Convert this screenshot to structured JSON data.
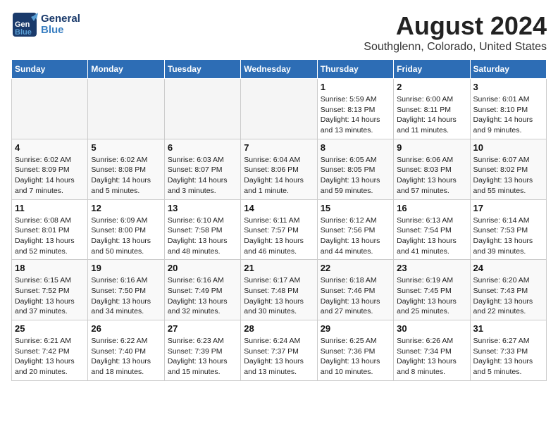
{
  "header": {
    "logo_general": "General",
    "logo_blue": "Blue",
    "month_year": "August 2024",
    "location": "Southglenn, Colorado, United States"
  },
  "weekdays": [
    "Sunday",
    "Monday",
    "Tuesday",
    "Wednesday",
    "Thursday",
    "Friday",
    "Saturday"
  ],
  "weeks": [
    [
      {
        "day": "",
        "info": ""
      },
      {
        "day": "",
        "info": ""
      },
      {
        "day": "",
        "info": ""
      },
      {
        "day": "",
        "info": ""
      },
      {
        "day": "1",
        "info": "Sunrise: 5:59 AM\nSunset: 8:13 PM\nDaylight: 14 hours\nand 13 minutes."
      },
      {
        "day": "2",
        "info": "Sunrise: 6:00 AM\nSunset: 8:11 PM\nDaylight: 14 hours\nand 11 minutes."
      },
      {
        "day": "3",
        "info": "Sunrise: 6:01 AM\nSunset: 8:10 PM\nDaylight: 14 hours\nand 9 minutes."
      }
    ],
    [
      {
        "day": "4",
        "info": "Sunrise: 6:02 AM\nSunset: 8:09 PM\nDaylight: 14 hours\nand 7 minutes."
      },
      {
        "day": "5",
        "info": "Sunrise: 6:02 AM\nSunset: 8:08 PM\nDaylight: 14 hours\nand 5 minutes."
      },
      {
        "day": "6",
        "info": "Sunrise: 6:03 AM\nSunset: 8:07 PM\nDaylight: 14 hours\nand 3 minutes."
      },
      {
        "day": "7",
        "info": "Sunrise: 6:04 AM\nSunset: 8:06 PM\nDaylight: 14 hours\nand 1 minute."
      },
      {
        "day": "8",
        "info": "Sunrise: 6:05 AM\nSunset: 8:05 PM\nDaylight: 13 hours\nand 59 minutes."
      },
      {
        "day": "9",
        "info": "Sunrise: 6:06 AM\nSunset: 8:03 PM\nDaylight: 13 hours\nand 57 minutes."
      },
      {
        "day": "10",
        "info": "Sunrise: 6:07 AM\nSunset: 8:02 PM\nDaylight: 13 hours\nand 55 minutes."
      }
    ],
    [
      {
        "day": "11",
        "info": "Sunrise: 6:08 AM\nSunset: 8:01 PM\nDaylight: 13 hours\nand 52 minutes."
      },
      {
        "day": "12",
        "info": "Sunrise: 6:09 AM\nSunset: 8:00 PM\nDaylight: 13 hours\nand 50 minutes."
      },
      {
        "day": "13",
        "info": "Sunrise: 6:10 AM\nSunset: 7:58 PM\nDaylight: 13 hours\nand 48 minutes."
      },
      {
        "day": "14",
        "info": "Sunrise: 6:11 AM\nSunset: 7:57 PM\nDaylight: 13 hours\nand 46 minutes."
      },
      {
        "day": "15",
        "info": "Sunrise: 6:12 AM\nSunset: 7:56 PM\nDaylight: 13 hours\nand 44 minutes."
      },
      {
        "day": "16",
        "info": "Sunrise: 6:13 AM\nSunset: 7:54 PM\nDaylight: 13 hours\nand 41 minutes."
      },
      {
        "day": "17",
        "info": "Sunrise: 6:14 AM\nSunset: 7:53 PM\nDaylight: 13 hours\nand 39 minutes."
      }
    ],
    [
      {
        "day": "18",
        "info": "Sunrise: 6:15 AM\nSunset: 7:52 PM\nDaylight: 13 hours\nand 37 minutes."
      },
      {
        "day": "19",
        "info": "Sunrise: 6:16 AM\nSunset: 7:50 PM\nDaylight: 13 hours\nand 34 minutes."
      },
      {
        "day": "20",
        "info": "Sunrise: 6:16 AM\nSunset: 7:49 PM\nDaylight: 13 hours\nand 32 minutes."
      },
      {
        "day": "21",
        "info": "Sunrise: 6:17 AM\nSunset: 7:48 PM\nDaylight: 13 hours\nand 30 minutes."
      },
      {
        "day": "22",
        "info": "Sunrise: 6:18 AM\nSunset: 7:46 PM\nDaylight: 13 hours\nand 27 minutes."
      },
      {
        "day": "23",
        "info": "Sunrise: 6:19 AM\nSunset: 7:45 PM\nDaylight: 13 hours\nand 25 minutes."
      },
      {
        "day": "24",
        "info": "Sunrise: 6:20 AM\nSunset: 7:43 PM\nDaylight: 13 hours\nand 22 minutes."
      }
    ],
    [
      {
        "day": "25",
        "info": "Sunrise: 6:21 AM\nSunset: 7:42 PM\nDaylight: 13 hours\nand 20 minutes."
      },
      {
        "day": "26",
        "info": "Sunrise: 6:22 AM\nSunset: 7:40 PM\nDaylight: 13 hours\nand 18 minutes."
      },
      {
        "day": "27",
        "info": "Sunrise: 6:23 AM\nSunset: 7:39 PM\nDaylight: 13 hours\nand 15 minutes."
      },
      {
        "day": "28",
        "info": "Sunrise: 6:24 AM\nSunset: 7:37 PM\nDaylight: 13 hours\nand 13 minutes."
      },
      {
        "day": "29",
        "info": "Sunrise: 6:25 AM\nSunset: 7:36 PM\nDaylight: 13 hours\nand 10 minutes."
      },
      {
        "day": "30",
        "info": "Sunrise: 6:26 AM\nSunset: 7:34 PM\nDaylight: 13 hours\nand 8 minutes."
      },
      {
        "day": "31",
        "info": "Sunrise: 6:27 AM\nSunset: 7:33 PM\nDaylight: 13 hours\nand 5 minutes."
      }
    ]
  ]
}
